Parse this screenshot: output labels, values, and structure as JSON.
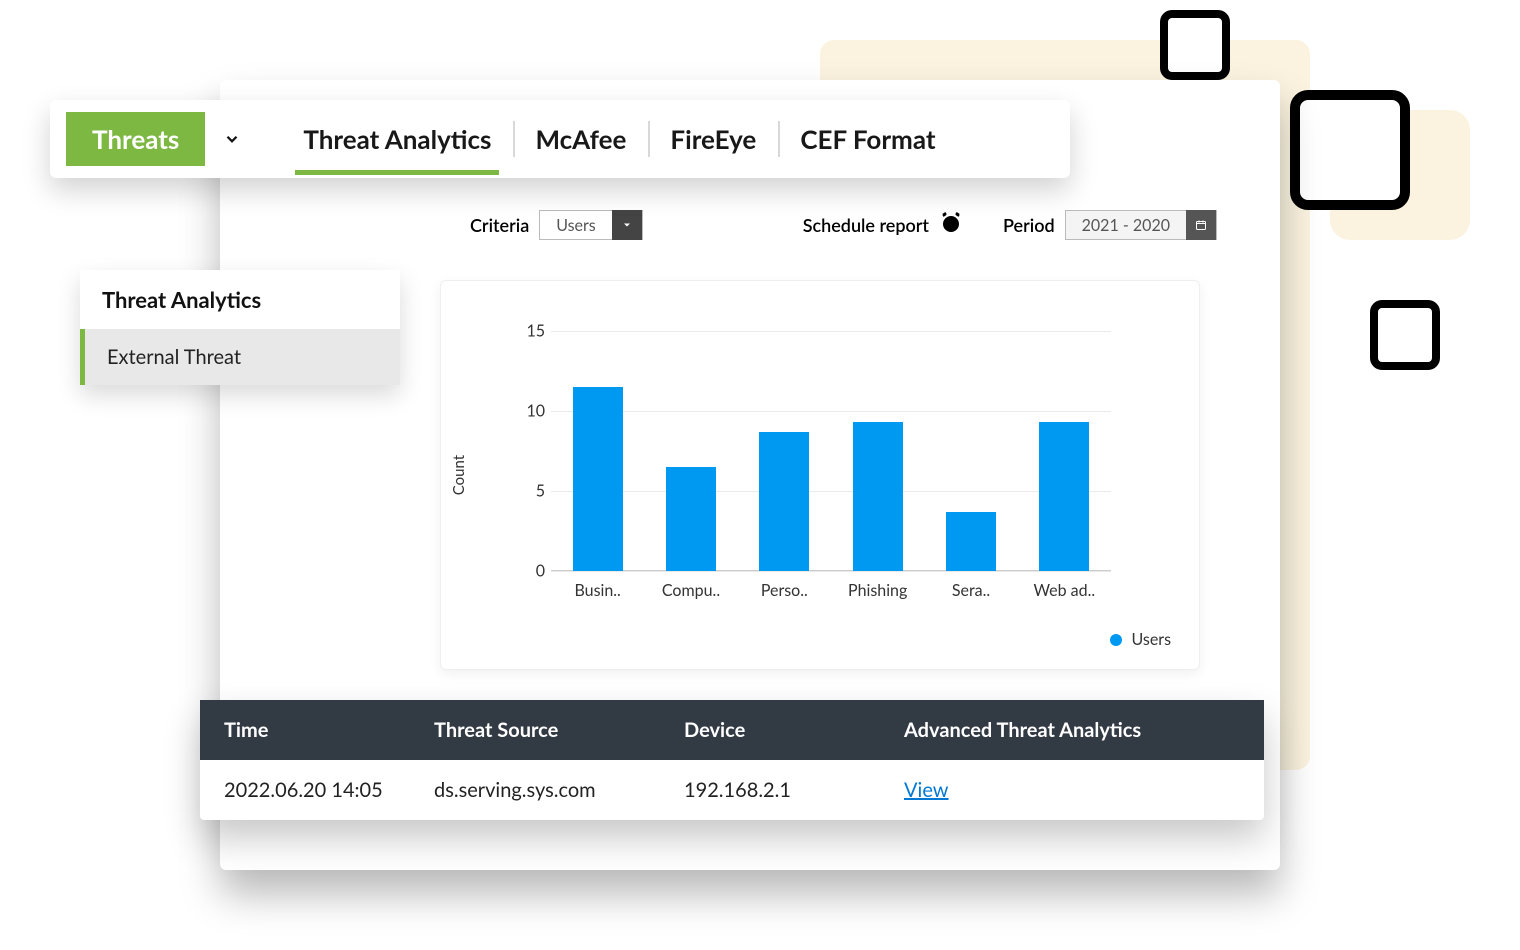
{
  "tabbar": {
    "threats_label": "Threats",
    "tabs": [
      "Threat Analytics",
      "McAfee",
      "FireEye",
      "CEF Format"
    ],
    "active_index": 0
  },
  "sidebar": {
    "header": "Threat Analytics",
    "items": [
      "External Threat"
    ]
  },
  "options": {
    "criteria_label": "Criteria",
    "criteria_value": "Users",
    "schedule_label": "Schedule report",
    "period_label": "Period",
    "period_value": "2021 - 2020"
  },
  "chart_data": {
    "type": "bar",
    "ylabel": "Count",
    "ylim": [
      0,
      15
    ],
    "yticks": [
      0,
      5,
      10,
      15
    ],
    "categories": [
      "Busin..",
      "Compu..",
      "Perso..",
      "Phishing",
      "Sera..",
      "Web ad.."
    ],
    "values": [
      11.5,
      6.5,
      8.7,
      9.3,
      3.7,
      9.3
    ],
    "legend": "Users",
    "bar_color": "#0099F2"
  },
  "table": {
    "headers": [
      "Time",
      "Threat Source",
      "Device",
      "Advanced Threat Analytics"
    ],
    "rows": [
      {
        "time": "2022.06.20 14:05",
        "source": "ds.serving.sys.com",
        "device": "192.168.2.1",
        "action": "View"
      }
    ]
  }
}
